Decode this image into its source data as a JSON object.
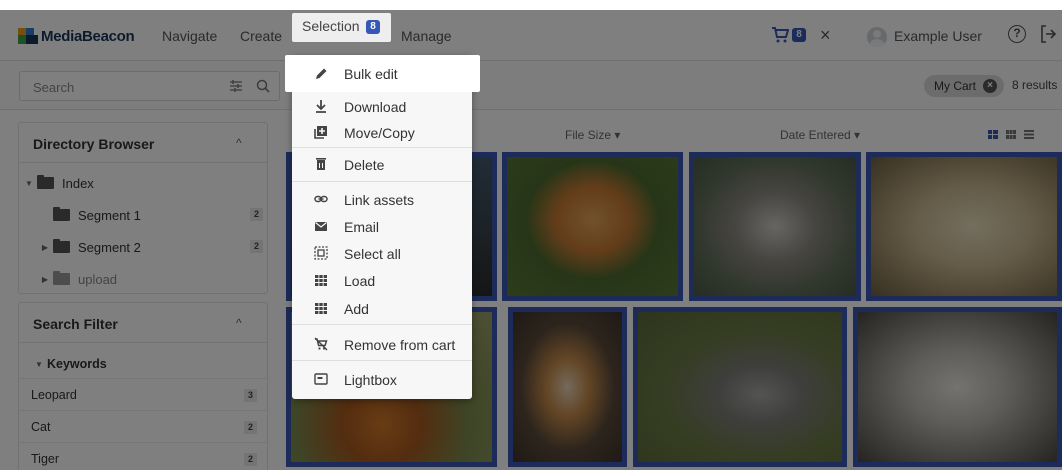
{
  "header": {
    "logo_text": "MediaBeacon",
    "nav": [
      "Navigate",
      "Create",
      "Selection",
      "Manage"
    ],
    "selection_count": "8",
    "cart_count": "8",
    "username": "Example User"
  },
  "search": {
    "placeholder": "Search",
    "my_cart_label": "My Cart",
    "results_text": "8 results"
  },
  "directory": {
    "title": "Directory Browser",
    "items": [
      {
        "label": "Index",
        "count": ""
      },
      {
        "label": "Segment 1",
        "count": "2"
      },
      {
        "label": "Segment 2",
        "count": "2"
      },
      {
        "label": "upload",
        "count": ""
      }
    ]
  },
  "filter": {
    "title": "Search Filter",
    "group": "Keywords",
    "rows": [
      {
        "label": "Leopard",
        "count": "3"
      },
      {
        "label": "Cat",
        "count": "2"
      },
      {
        "label": "Tiger",
        "count": "2"
      }
    ]
  },
  "grid": {
    "columns": [
      "File Size",
      "Date Entered"
    ],
    "accent": "#3a57b4"
  },
  "menu": {
    "items": [
      {
        "label": "Bulk edit",
        "icon": "pencil-icon"
      },
      {
        "label": "Download",
        "icon": "download-icon"
      },
      {
        "label": "Move/Copy",
        "icon": "move-copy-icon"
      },
      {
        "label": "Delete",
        "icon": "trash-icon"
      },
      {
        "label": "Link assets",
        "icon": "link-icon"
      },
      {
        "label": "Email",
        "icon": "mail-icon"
      },
      {
        "label": "Select all",
        "icon": "select-all-icon"
      },
      {
        "label": "Load",
        "icon": "grid-load-icon"
      },
      {
        "label": "Add",
        "icon": "grid-add-icon"
      },
      {
        "label": "Remove from cart",
        "icon": "remove-cart-icon"
      },
      {
        "label": "Lightbox",
        "icon": "lightbox-icon"
      }
    ]
  }
}
